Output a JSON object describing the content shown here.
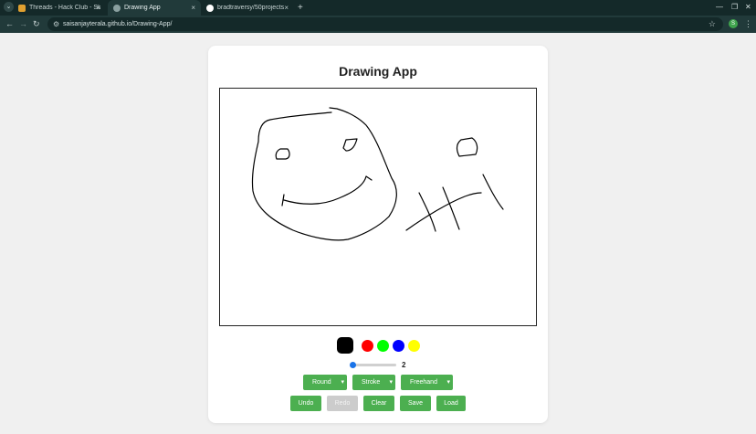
{
  "browser": {
    "tabs": [
      {
        "title": "Threads - Hack Club - Sla",
        "favicon_color": "#e0a030",
        "active": false
      },
      {
        "title": "Drawing App",
        "favicon_color": "#8aa0a0",
        "active": true
      },
      {
        "title": "bradtraversy/50projects",
        "favicon_color": "#ffffff",
        "active": false
      }
    ],
    "new_tab_label": "+",
    "tab_close_label": "×",
    "url": "saisanjayterala.github.io/Drawing-App/",
    "profile_initial": "S"
  },
  "app": {
    "title": "Drawing App",
    "colors": [
      {
        "name": "black",
        "hex": "#000000",
        "selected": true
      },
      {
        "name": "red",
        "hex": "#ff0000",
        "selected": false
      },
      {
        "name": "green",
        "hex": "#00ff00",
        "selected": false
      },
      {
        "name": "blue",
        "hex": "#0000ff",
        "selected": false
      },
      {
        "name": "yellow",
        "hex": "#ffff00",
        "selected": false
      }
    ],
    "brush_size": {
      "value": "2",
      "min": 1,
      "max": 50
    },
    "selects": {
      "cap": "Round",
      "style": "Stroke",
      "mode": "Freehand"
    },
    "buttons": {
      "undo": "Undo",
      "redo": "Redo",
      "clear": "Clear",
      "save": "Save",
      "load": "Load"
    },
    "accent_color": "#4caf50"
  }
}
